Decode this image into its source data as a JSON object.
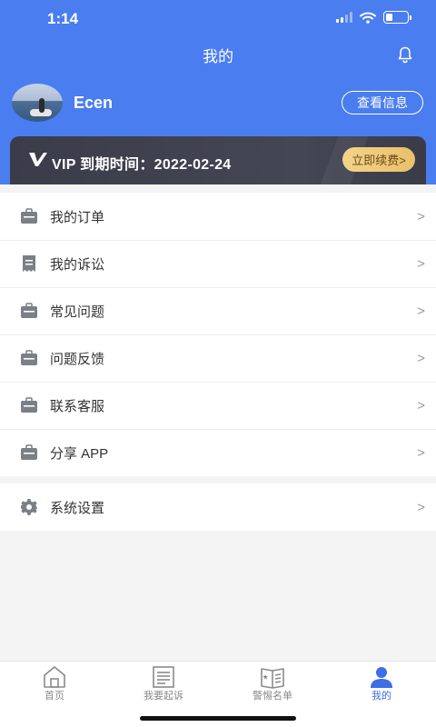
{
  "status": {
    "time": "1:14",
    "battery_level": 0.3
  },
  "header": {
    "title": "我的",
    "bell_icon": "bell-icon"
  },
  "profile": {
    "username": "Ecen",
    "info_button": "查看信息"
  },
  "vip": {
    "text": "VIP 到期时间：2022-02-24",
    "renew_button": "立即续费>"
  },
  "menu": {
    "group1": [
      {
        "label": "我的订单",
        "icon": "briefcase-icon"
      },
      {
        "label": "我的诉讼",
        "icon": "receipt-icon"
      },
      {
        "label": "常见问题",
        "icon": "briefcase-icon"
      },
      {
        "label": "问题反馈",
        "icon": "briefcase-icon"
      },
      {
        "label": "联系客服",
        "icon": "briefcase-icon"
      },
      {
        "label": "分享 APP",
        "icon": "briefcase-icon"
      }
    ],
    "group2": [
      {
        "label": "系统设置",
        "icon": "gear-icon"
      }
    ],
    "arrow": ">"
  },
  "tabbar": {
    "tabs": [
      {
        "label": "首页",
        "icon": "home-icon"
      },
      {
        "label": "我要起诉",
        "icon": "document-icon"
      },
      {
        "label": "警惕名单",
        "icon": "book-icon"
      },
      {
        "label": "我的",
        "icon": "user-icon"
      }
    ],
    "active_index": 3
  },
  "colors": {
    "primary": "#4a7df0",
    "vip_bg": "#3b3c4a",
    "renew": "#f3d48a",
    "active_tab": "#3c6ee6"
  }
}
